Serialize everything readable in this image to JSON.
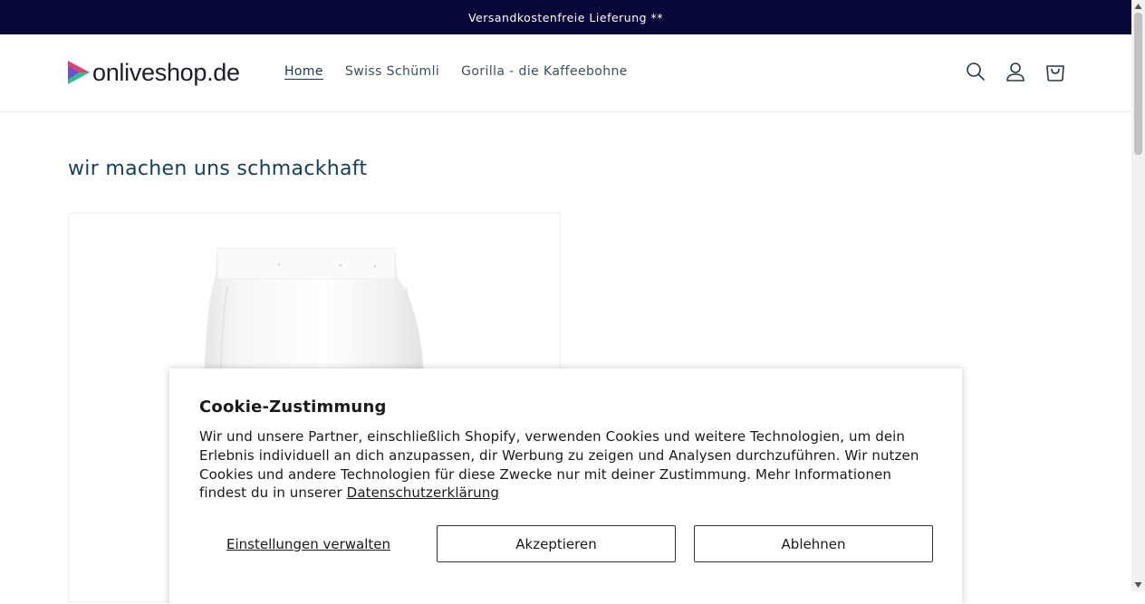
{
  "announcement": {
    "text": "Versandkostenfreie Lieferung **"
  },
  "header": {
    "logo_text": "onliveshop.de",
    "nav": [
      {
        "label": "Home"
      },
      {
        "label": "Swiss Schümli"
      },
      {
        "label": "Gorilla - die Kaffeebohne"
      }
    ],
    "icons": [
      "search-icon",
      "account-icon",
      "cart-icon"
    ]
  },
  "main": {
    "heading": "wir machen uns schmackhaft"
  },
  "cookie_banner": {
    "title": "Cookie-Zustimmung",
    "text": "Wir und unsere Partner, einschließlich Shopify, verwenden Cookies und weitere Technologien, um dein Erlebnis individuell an dich anzupassen, dir Werbung zu zeigen und Analysen durchzuführen. Wir nutzen Cookies und andere Technologien für diese Zwecke nur mit deiner Zustimmung. Mehr Informationen findest du in unserer ",
    "link": "Datenschutzerklärung",
    "manage_label": "Einstellungen verwalten",
    "accept_label": "Akzeptieren",
    "decline_label": "Ablehnen"
  },
  "colors": {
    "announcement_bg": "#070738",
    "heading": "#15405e",
    "nav_text": "#3b4f5e",
    "logo_accents": [
      "#e83e6b",
      "#6a4fd8",
      "#2fbf8f"
    ]
  }
}
